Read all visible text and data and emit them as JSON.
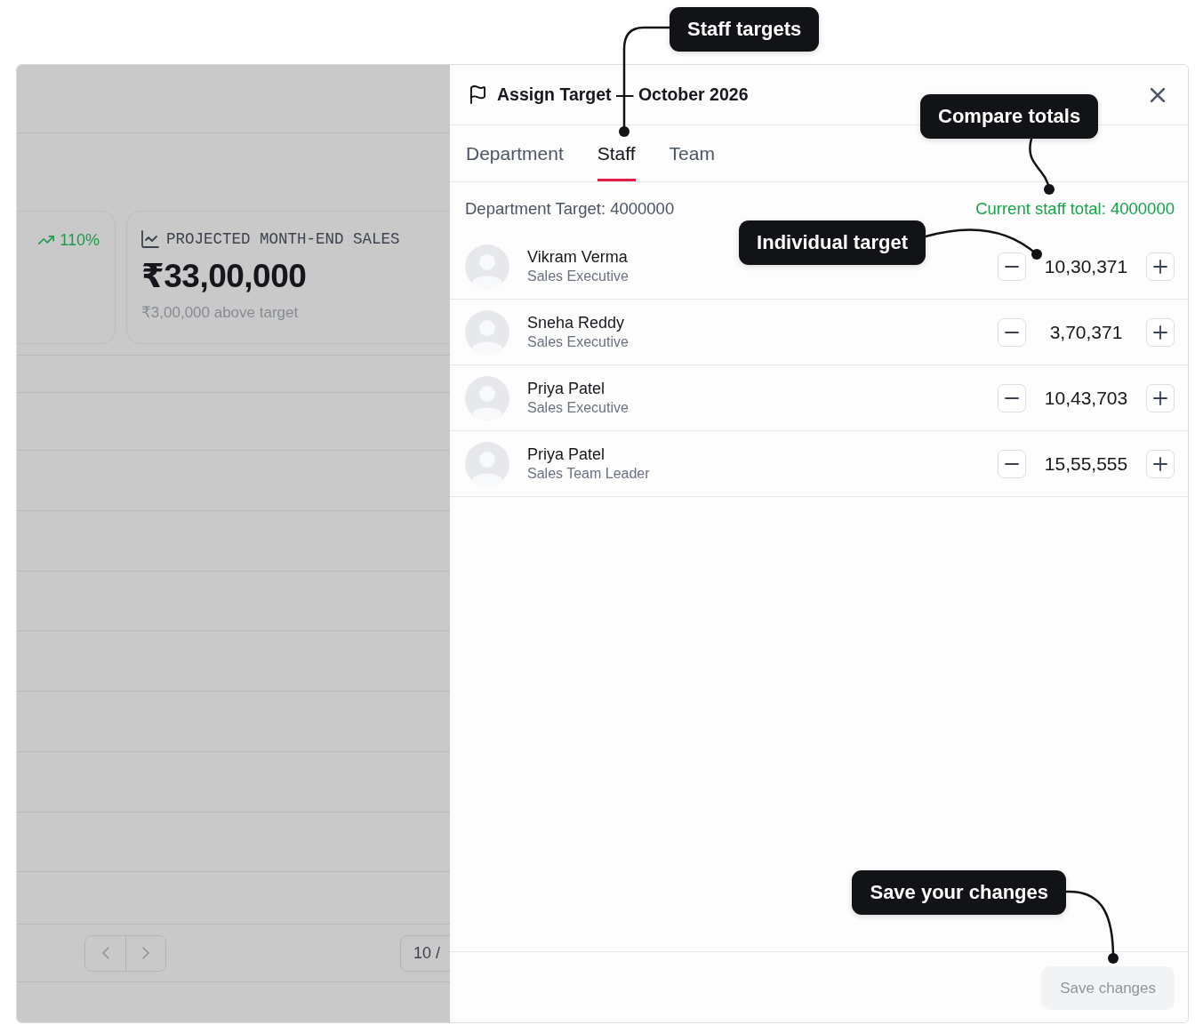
{
  "backdrop": {
    "cards": [
      {
        "kind": "trend",
        "trend": "110%"
      },
      {
        "kind": "metric",
        "title": "PROJECTED MONTH-END SALES",
        "value": "₹33,00,000",
        "note": "₹3,00,000 above target"
      }
    ],
    "page_size": "10 /"
  },
  "drawer": {
    "title": "Assign Target — October 2026",
    "tabs": [
      {
        "label": "Department",
        "selected": false
      },
      {
        "label": "Staff",
        "selected": true
      },
      {
        "label": "Team",
        "selected": false
      }
    ],
    "department_target": "Department Target: 4000000",
    "staff_total": "Current staff total: 4000000",
    "staff": [
      {
        "name": "Vikram Verma",
        "role": "Sales Executive",
        "target": "10,30,371"
      },
      {
        "name": "Sneha Reddy",
        "role": "Sales Executive",
        "target": "3,70,371"
      },
      {
        "name": "Priya Patel",
        "role": "Sales Executive",
        "target": "10,43,703"
      },
      {
        "name": "Priya Patel",
        "role": "Sales Team Leader",
        "target": "15,55,555"
      }
    ],
    "save_button": {
      "label": "Save changes",
      "disabled": true
    }
  },
  "callouts": [
    {
      "text": "Staff targets"
    },
    {
      "text": "Compare totals"
    },
    {
      "text": "Individual target"
    },
    {
      "text": "Save your changes"
    }
  ]
}
